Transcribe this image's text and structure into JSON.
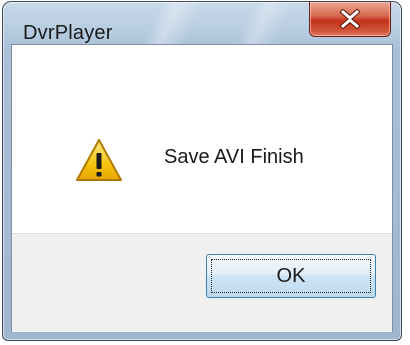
{
  "window": {
    "title": "DvrPlayer",
    "close_icon": "close-icon"
  },
  "dialog": {
    "icon": "warning-icon",
    "message": "Save AVI Finish",
    "ok_label": "OK"
  },
  "colors": {
    "close_button_red": "#c2331a",
    "frame_blue": "#a9bfd6",
    "button_area_gray": "#f0f0f0",
    "warning_yellow": "#f6c40f"
  }
}
